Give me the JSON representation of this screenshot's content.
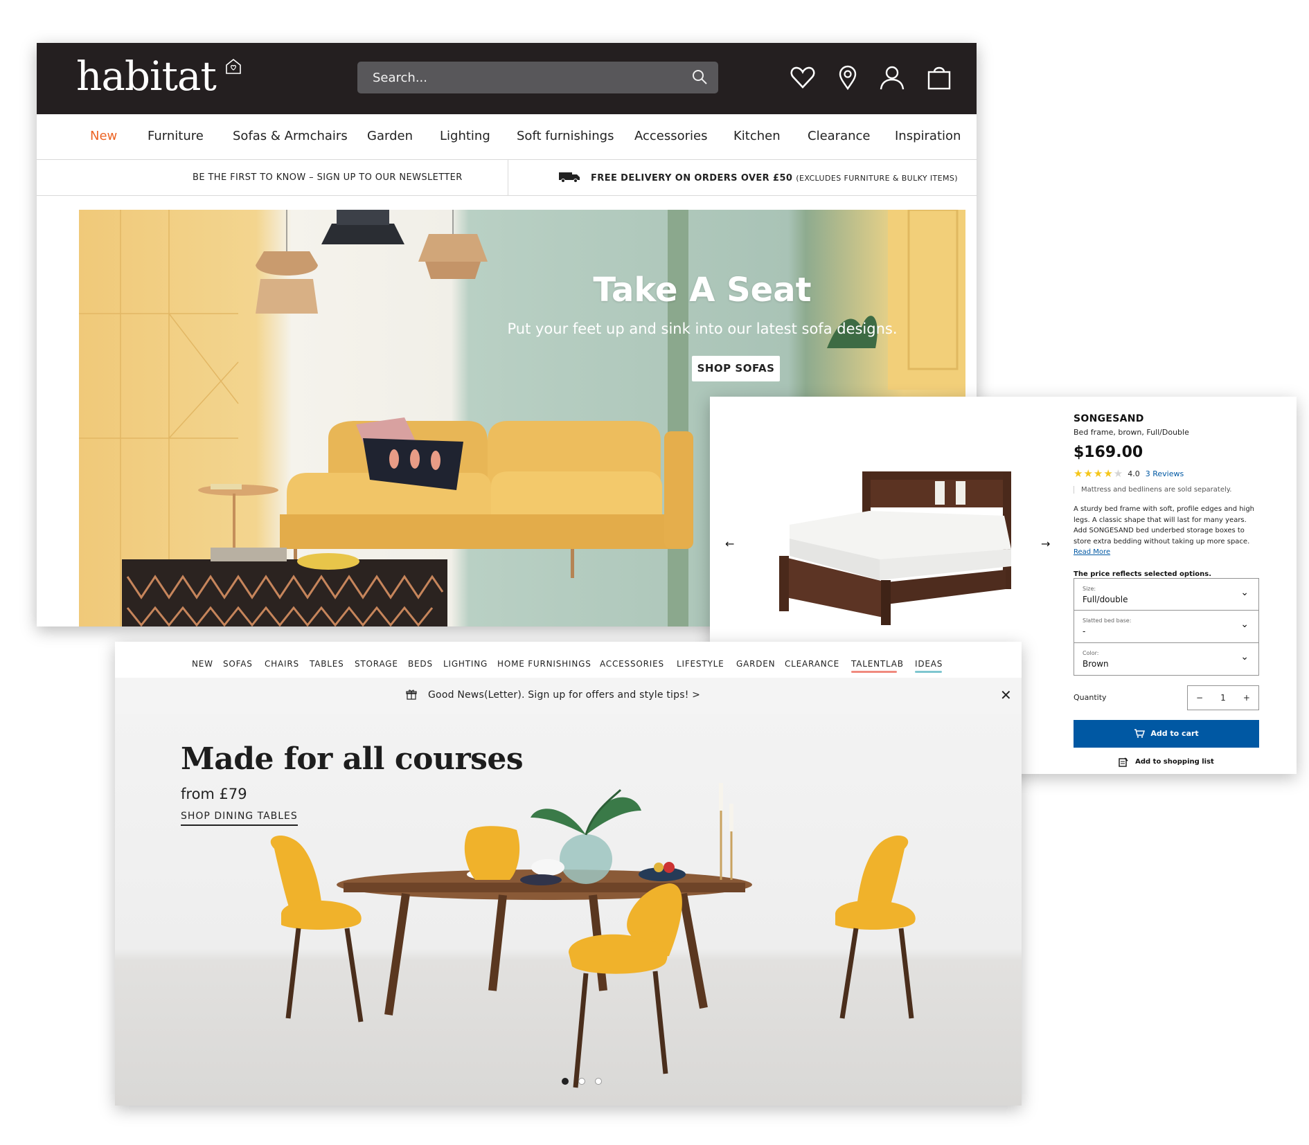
{
  "habitat": {
    "logo": "habitat",
    "search": {
      "placeholder": "Search..."
    },
    "header_icons": [
      "heart-icon",
      "location-pin-icon",
      "user-icon",
      "shopping-bag-icon"
    ],
    "nav": [
      "New",
      "Furniture",
      "Sofas & Armchairs",
      "Garden",
      "Lighting",
      "Soft furnishings",
      "Accessories",
      "Kitchen",
      "Clearance",
      "Inspiration"
    ],
    "promo_left": "BE THE FIRST TO KNOW – SIGN UP TO OUR NEWSLETTER",
    "promo_right": "FREE DELIVERY ON ORDERS OVER £50",
    "promo_right_note": "(EXCLUDES FURNITURE & BULKY ITEMS)",
    "hero": {
      "title": "Take A Seat",
      "subtitle": "Put your feet up and sink into our latest sofa designs.",
      "cta": "SHOP SOFAS"
    },
    "colors": {
      "header_bg": "#241f20",
      "accent": "#ec6424"
    }
  },
  "ikea": {
    "name": "SONGESAND",
    "description": "Bed frame, brown, Full/Double",
    "price": "$169.00",
    "rating": {
      "stars": 4,
      "max": 5,
      "score": "4.0",
      "reviews": "3 Reviews"
    },
    "note": "Mattress and bedlinens are sold separately.",
    "body": "A sturdy bed frame with soft, profile edges and high legs. A classic shape that will last for many years. Add SONGESAND bed underbed storage boxes to store extra bedding without taking up more space.",
    "read_more": "Read More",
    "reflect": "The price reflects selected options.",
    "options": [
      {
        "label": "Size:",
        "value": "Full/double"
      },
      {
        "label": "Slatted bed base:",
        "value": "-"
      },
      {
        "label": "Color:",
        "value": "Brown"
      }
    ],
    "quantity_label": "Quantity",
    "quantity": "1",
    "add_to_cart": "Add to cart",
    "add_to_list": "Add to shopping list",
    "colors": {
      "primary": "#0058a3",
      "star": "#f5c61a"
    }
  },
  "made": {
    "nav": [
      "NEW",
      "SOFAS",
      "CHAIRS",
      "TABLES",
      "STORAGE",
      "BEDS",
      "LIGHTING",
      "HOME FURNISHINGS",
      "ACCESSORIES",
      "LIFESTYLE",
      "GARDEN",
      "CLEARANCE",
      "TALENTLAB",
      "IDEAS"
    ],
    "newsletter": "Good News(Letter). Sign up for offers and style tips! >",
    "hero": {
      "title": "Made for all courses",
      "from": "from £79",
      "cta": "SHOP DINING TABLES"
    },
    "carousel": {
      "slides": 3,
      "active": 1
    },
    "colors": {
      "talentlab_underline": "#f08a7e",
      "ideas_underline": "#7ec6cf",
      "chair": "#f0b22b"
    }
  }
}
